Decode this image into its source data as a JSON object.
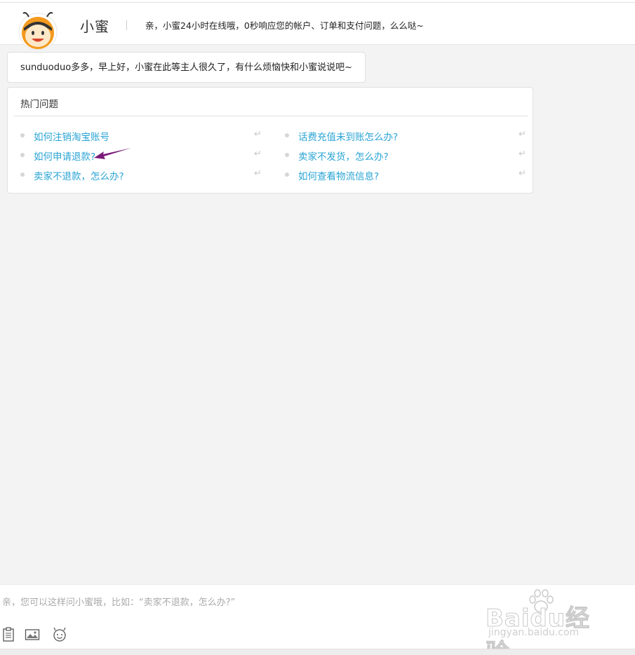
{
  "header": {
    "bot_name": "小蜜",
    "tagline": "亲，小蜜24小时在线哦，0秒响应您的帐户、订单和支付问题，么么哒~"
  },
  "greeting": "sunduoduo多多，早上好，小蜜在此等主人很久了，有什么烦恼快和小蜜说说吧~",
  "hot_questions": {
    "title": "热门问题",
    "left": [
      "如何注销淘宝账号",
      "如何申请退款?",
      "卖家不退款，怎么办?"
    ],
    "right": [
      "话费充值未到账怎么办?",
      "卖家不发货，怎么办?",
      "如何查看物流信息?"
    ],
    "enter_glyph": "↵"
  },
  "input": {
    "placeholder": "亲，您可以这样问小蜜哦，比如：“卖家不退款，怎么办?”"
  },
  "toolbar": {
    "icons": [
      "clipboard-icon",
      "image-icon",
      "emoji-icon"
    ]
  },
  "watermark": {
    "main": "Baidu经验",
    "sub": "jingyan.baidu.com"
  },
  "colors": {
    "link": "#2aa4d4",
    "arrow": "#7b1a78",
    "avatar_orange": "#f39a1e"
  }
}
